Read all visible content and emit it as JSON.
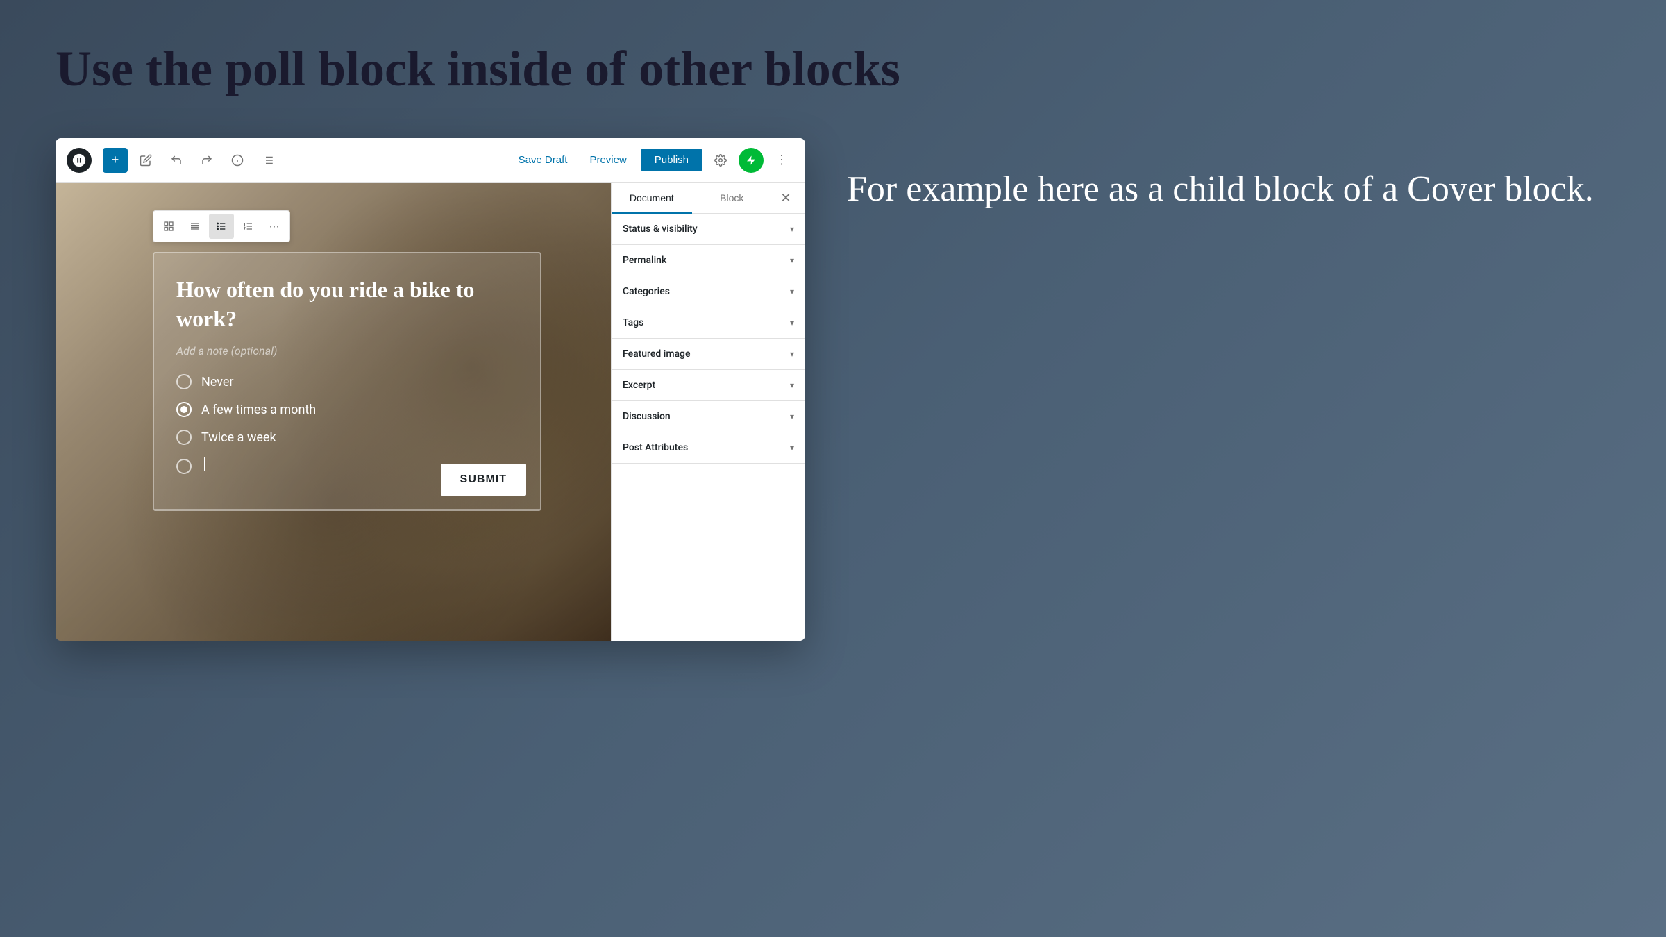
{
  "page": {
    "title": "Use the poll block inside of other blocks"
  },
  "editor": {
    "toolbar": {
      "add_label": "+",
      "save_draft_label": "Save Draft",
      "preview_label": "Preview",
      "publish_label": "Publish",
      "more_label": "⋮"
    },
    "block_toolbar": {
      "btns": [
        "⊞",
        "≡",
        "☰",
        "☲",
        "⋯"
      ]
    },
    "poll": {
      "question": "How often do you ride a bike to work?",
      "note_placeholder": "Add a note (optional)",
      "options": [
        "Never",
        "A few times a month",
        "Twice a week",
        ""
      ],
      "submit_label": "SUBMIT"
    },
    "sidebar": {
      "tabs": [
        "Document",
        "Block"
      ],
      "active_tab": "Document",
      "sections": [
        "Status & visibility",
        "Permalink",
        "Categories",
        "Tags",
        "Featured image",
        "Excerpt",
        "Discussion",
        "Post Attributes"
      ]
    }
  },
  "side_text": {
    "description": "For example here as a child block of a Cover block."
  }
}
